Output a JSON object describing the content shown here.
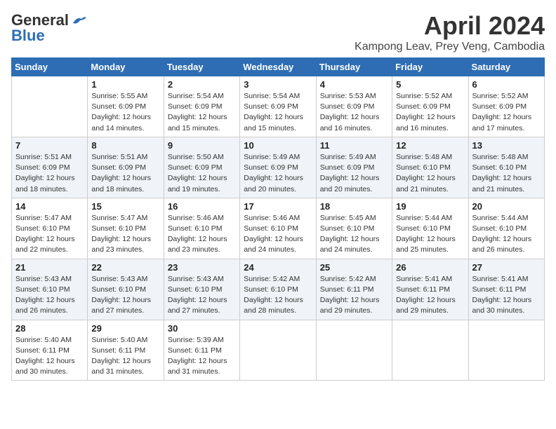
{
  "header": {
    "logo_general": "General",
    "logo_blue": "Blue",
    "month_title": "April 2024",
    "location": "Kampong Leav, Prey Veng, Cambodia"
  },
  "weekdays": [
    "Sunday",
    "Monday",
    "Tuesday",
    "Wednesday",
    "Thursday",
    "Friday",
    "Saturday"
  ],
  "weeks": [
    [
      {
        "day": "",
        "info": ""
      },
      {
        "day": "1",
        "info": "Sunrise: 5:55 AM\nSunset: 6:09 PM\nDaylight: 12 hours\nand 14 minutes."
      },
      {
        "day": "2",
        "info": "Sunrise: 5:54 AM\nSunset: 6:09 PM\nDaylight: 12 hours\nand 15 minutes."
      },
      {
        "day": "3",
        "info": "Sunrise: 5:54 AM\nSunset: 6:09 PM\nDaylight: 12 hours\nand 15 minutes."
      },
      {
        "day": "4",
        "info": "Sunrise: 5:53 AM\nSunset: 6:09 PM\nDaylight: 12 hours\nand 16 minutes."
      },
      {
        "day": "5",
        "info": "Sunrise: 5:52 AM\nSunset: 6:09 PM\nDaylight: 12 hours\nand 16 minutes."
      },
      {
        "day": "6",
        "info": "Sunrise: 5:52 AM\nSunset: 6:09 PM\nDaylight: 12 hours\nand 17 minutes."
      }
    ],
    [
      {
        "day": "7",
        "info": "Sunrise: 5:51 AM\nSunset: 6:09 PM\nDaylight: 12 hours\nand 18 minutes."
      },
      {
        "day": "8",
        "info": "Sunrise: 5:51 AM\nSunset: 6:09 PM\nDaylight: 12 hours\nand 18 minutes."
      },
      {
        "day": "9",
        "info": "Sunrise: 5:50 AM\nSunset: 6:09 PM\nDaylight: 12 hours\nand 19 minutes."
      },
      {
        "day": "10",
        "info": "Sunrise: 5:49 AM\nSunset: 6:09 PM\nDaylight: 12 hours\nand 20 minutes."
      },
      {
        "day": "11",
        "info": "Sunrise: 5:49 AM\nSunset: 6:09 PM\nDaylight: 12 hours\nand 20 minutes."
      },
      {
        "day": "12",
        "info": "Sunrise: 5:48 AM\nSunset: 6:10 PM\nDaylight: 12 hours\nand 21 minutes."
      },
      {
        "day": "13",
        "info": "Sunrise: 5:48 AM\nSunset: 6:10 PM\nDaylight: 12 hours\nand 21 minutes."
      }
    ],
    [
      {
        "day": "14",
        "info": "Sunrise: 5:47 AM\nSunset: 6:10 PM\nDaylight: 12 hours\nand 22 minutes."
      },
      {
        "day": "15",
        "info": "Sunrise: 5:47 AM\nSunset: 6:10 PM\nDaylight: 12 hours\nand 23 minutes."
      },
      {
        "day": "16",
        "info": "Sunrise: 5:46 AM\nSunset: 6:10 PM\nDaylight: 12 hours\nand 23 minutes."
      },
      {
        "day": "17",
        "info": "Sunrise: 5:46 AM\nSunset: 6:10 PM\nDaylight: 12 hours\nand 24 minutes."
      },
      {
        "day": "18",
        "info": "Sunrise: 5:45 AM\nSunset: 6:10 PM\nDaylight: 12 hours\nand 24 minutes."
      },
      {
        "day": "19",
        "info": "Sunrise: 5:44 AM\nSunset: 6:10 PM\nDaylight: 12 hours\nand 25 minutes."
      },
      {
        "day": "20",
        "info": "Sunrise: 5:44 AM\nSunset: 6:10 PM\nDaylight: 12 hours\nand 26 minutes."
      }
    ],
    [
      {
        "day": "21",
        "info": "Sunrise: 5:43 AM\nSunset: 6:10 PM\nDaylight: 12 hours\nand 26 minutes."
      },
      {
        "day": "22",
        "info": "Sunrise: 5:43 AM\nSunset: 6:10 PM\nDaylight: 12 hours\nand 27 minutes."
      },
      {
        "day": "23",
        "info": "Sunrise: 5:43 AM\nSunset: 6:10 PM\nDaylight: 12 hours\nand 27 minutes."
      },
      {
        "day": "24",
        "info": "Sunrise: 5:42 AM\nSunset: 6:10 PM\nDaylight: 12 hours\nand 28 minutes."
      },
      {
        "day": "25",
        "info": "Sunrise: 5:42 AM\nSunset: 6:11 PM\nDaylight: 12 hours\nand 29 minutes."
      },
      {
        "day": "26",
        "info": "Sunrise: 5:41 AM\nSunset: 6:11 PM\nDaylight: 12 hours\nand 29 minutes."
      },
      {
        "day": "27",
        "info": "Sunrise: 5:41 AM\nSunset: 6:11 PM\nDaylight: 12 hours\nand 30 minutes."
      }
    ],
    [
      {
        "day": "28",
        "info": "Sunrise: 5:40 AM\nSunset: 6:11 PM\nDaylight: 12 hours\nand 30 minutes."
      },
      {
        "day": "29",
        "info": "Sunrise: 5:40 AM\nSunset: 6:11 PM\nDaylight: 12 hours\nand 31 minutes."
      },
      {
        "day": "30",
        "info": "Sunrise: 5:39 AM\nSunset: 6:11 PM\nDaylight: 12 hours\nand 31 minutes."
      },
      {
        "day": "",
        "info": ""
      },
      {
        "day": "",
        "info": ""
      },
      {
        "day": "",
        "info": ""
      },
      {
        "day": "",
        "info": ""
      }
    ]
  ]
}
